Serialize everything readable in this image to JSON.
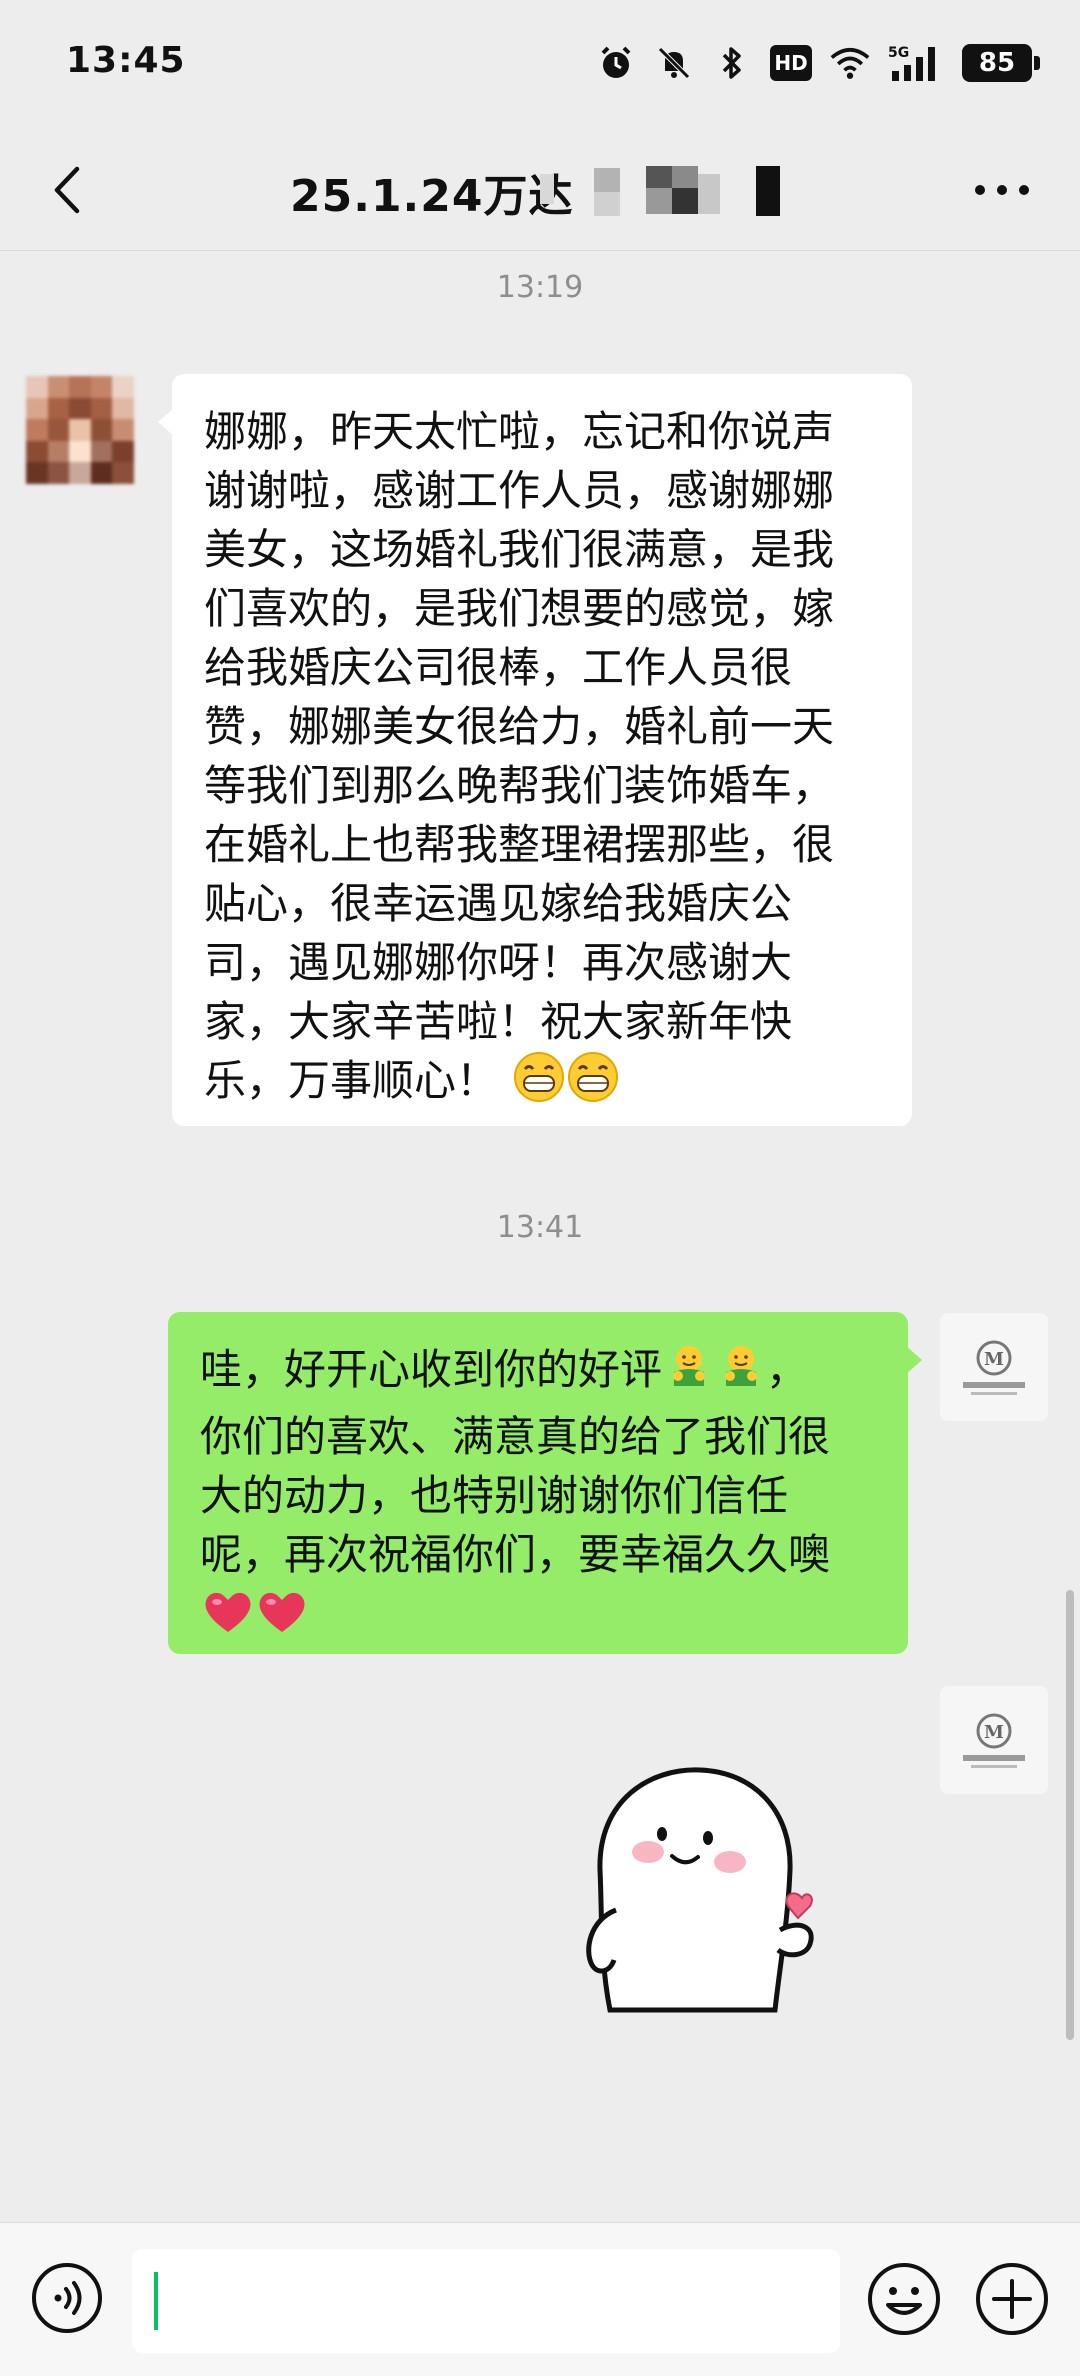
{
  "status_bar": {
    "time": "13:45",
    "icons": [
      "alarm-icon",
      "mute-bell-icon",
      "bluetooth-icon",
      "hd-icon",
      "wifi-icon",
      "5g-signal-icon",
      "battery-icon"
    ],
    "hd_label": "HD",
    "network_label": "5G",
    "battery": "85"
  },
  "header": {
    "title": "25.1.24万达",
    "back_icon": "chevron-left-icon",
    "more_icon": "more-dots-icon"
  },
  "messages": [
    {
      "timestamp": "13:19",
      "direction": "incoming",
      "lines": [
        "娜娜，昨天太忙啦，忘记和你说声",
        "谢谢啦，感谢工作人员，感谢娜娜",
        "美女，这场婚礼我们很满意，是我",
        "们喜欢的，是我们想要的感觉，嫁",
        "给我婚庆公司很棒，工作人员很",
        "赞，娜娜美女很给力，婚礼前一天",
        "等我们到那么晚帮我们装饰婚车，",
        "在婚礼上也帮我整理裙摆那些，很",
        "贴心，很幸运遇见嫁给我婚庆公",
        "司，遇见娜娜你呀！再次感谢大",
        "家，大家辛苦啦！祝大家新年快",
        "乐，万事顺心！"
      ],
      "trailing_emoji": [
        "grin-emoji",
        "grin-emoji"
      ]
    },
    {
      "timestamp": "13:41",
      "direction": "outgoing",
      "lines": [
        "哇，好开心收到你的好评",
        "你们的喜欢、满意真的给了我们很",
        "大的动力，也特别谢谢你们信任",
        "呢，再次祝福你们，要幸福久久噢"
      ],
      "line1_tail": "，",
      "inline_emoji": [
        "hug-emoji",
        "hug-emoji"
      ],
      "trailing_emoji": [
        "heart-emoji",
        "heart-emoji"
      ]
    },
    {
      "direction": "outgoing",
      "sticker": "finger-heart-sticker"
    }
  ],
  "colors": {
    "background": "#ededed",
    "incoming_bubble": "#ffffff",
    "outgoing_bubble": "#95ec69",
    "caret": "#07c160"
  },
  "input_bar": {
    "value": "",
    "voice_icon": "voice-icon",
    "emoji_icon": "emoji-smile-icon",
    "plus_icon": "plus-circle-icon"
  }
}
